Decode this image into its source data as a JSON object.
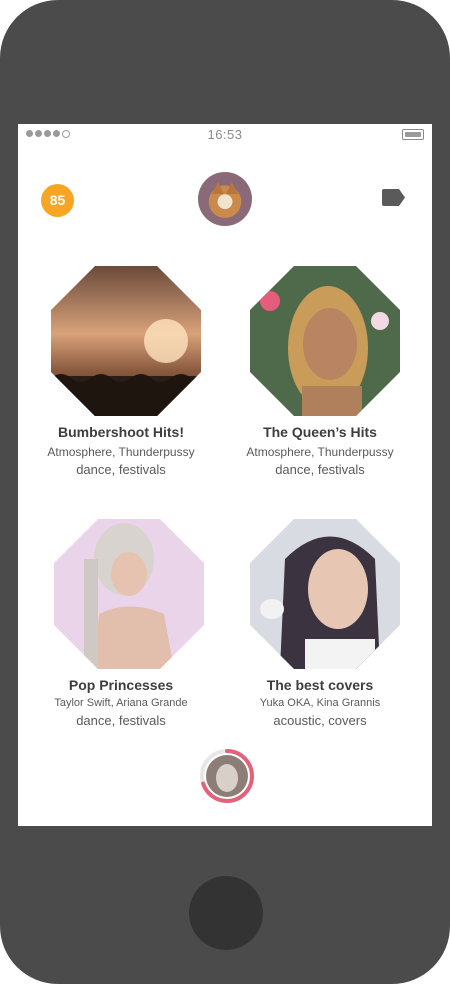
{
  "status_bar": {
    "time": "16:53"
  },
  "header": {
    "score": "85"
  },
  "playlists": [
    {
      "title": "Bumbershoot Hits!",
      "artists": "Atmosphere, Thunderpussy",
      "genres": "dance, festivals"
    },
    {
      "title": "The Queen’s Hits",
      "artists": "Atmosphere, Thunderpussy",
      "genres": "dance, festivals"
    },
    {
      "title": "Pop Princesses",
      "artists": "Taylor Swift, Ariana Grande",
      "genres": "dance, festivals"
    },
    {
      "title": "The best covers",
      "artists": "Yuka OKA, Kina Grannis",
      "genres": "acoustic, covers"
    }
  ],
  "player": {
    "progress": 0.7
  },
  "colors": {
    "score_badge": "#f6a623",
    "player_ring": "#e3627a",
    "phone_body": "#4b4b4b"
  }
}
